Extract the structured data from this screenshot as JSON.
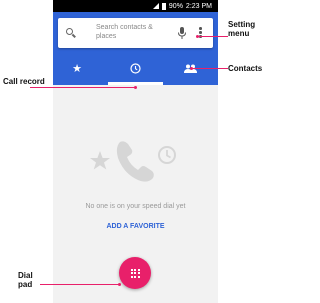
{
  "status_bar": {
    "battery": "90%",
    "time": "2:23 PM"
  },
  "search": {
    "placeholder": "Search contacts & places"
  },
  "tabs": [
    "speed-dial",
    "recents",
    "contacts"
  ],
  "empty_state": {
    "message": "No one is on your speed dial yet",
    "action": "ADD A FAVORITE"
  },
  "annotations": {
    "setting_menu": "Setting menu",
    "contacts": "Contacts",
    "call_record": "Call record",
    "dial_pad": "Dial pad"
  },
  "colors": {
    "primary": "#2f63d6",
    "accent": "#e8206a"
  }
}
